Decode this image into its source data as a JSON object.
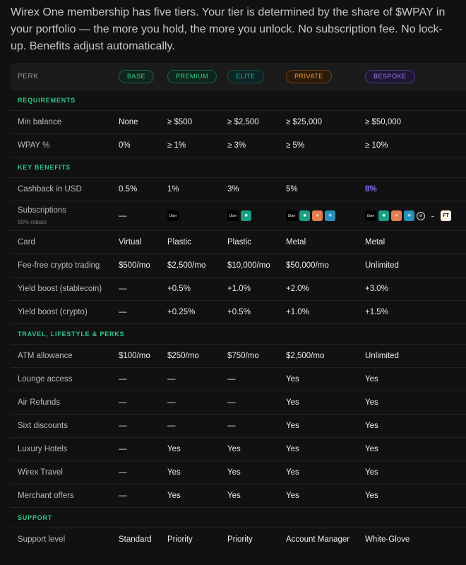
{
  "intro": "Wirex One membership has five tiers. Your tier is determined by the share of $WPAY in your portfolio — the more you hold, the more you unlock. No subscription fee. No lock-up. Benefits adjust automatically.",
  "header": {
    "perk": "PERK",
    "tiers": [
      "BASE",
      "PREMIUM",
      "ELITE",
      "PRIVATE",
      "BESPOKE"
    ]
  },
  "sections": {
    "requirements": "REQUIREMENTS",
    "key_benefits": "KEY BENEFITS",
    "travel": "TRAVEL, LIFESTYLE & PERKS",
    "support": "SUPPORT"
  },
  "rows": {
    "min_balance": {
      "label": "Min balance",
      "values": [
        "None",
        "≥ $500",
        "≥ $2,500",
        "≥ $25,000",
        "≥ $50,000"
      ]
    },
    "wpay": {
      "label": "WPAY %",
      "values": [
        "0%",
        "≥ 1%",
        "≥ 3%",
        "≥ 5%",
        "≥ 10%"
      ]
    },
    "cashback": {
      "label": "Cashback in USD",
      "values": [
        "0.5%",
        "1%",
        "3%",
        "5%",
        "8%"
      ]
    },
    "subscriptions": {
      "label": "Subscriptions",
      "note": "50% rebate",
      "base_value": "—"
    },
    "card": {
      "label": "Card",
      "values": [
        "Virtual",
        "Plastic",
        "Plastic",
        "Metal",
        "Metal"
      ]
    },
    "fee_free": {
      "label": "Fee-free crypto trading",
      "values": [
        "$500/mo",
        "$2,500/mo",
        "$10,000/mo",
        "$50,000/mo",
        "Unlimited"
      ]
    },
    "yield_stable": {
      "label": "Yield boost (stablecoin)",
      "values": [
        "—",
        "+0.5%",
        "+1.0%",
        "+2.0%",
        "+3.0%"
      ]
    },
    "yield_crypto": {
      "label": "Yield boost (crypto)",
      "values": [
        "—",
        "+0.25%",
        "+0.5%",
        "+1.0%",
        "+1.5%"
      ]
    },
    "atm": {
      "label": "ATM allowance",
      "values": [
        "$100/mo",
        "$250/mo",
        "$750/mo",
        "$2,500/mo",
        "Unlimited"
      ]
    },
    "lounge": {
      "label": "Lounge access",
      "values": [
        "—",
        "—",
        "—",
        "Yes",
        "Yes"
      ]
    },
    "air_refunds": {
      "label": "Air Refunds",
      "values": [
        "—",
        "—",
        "—",
        "Yes",
        "Yes"
      ]
    },
    "sixt": {
      "label": "Sixt discounts",
      "values": [
        "—",
        "—",
        "—",
        "Yes",
        "Yes"
      ]
    },
    "hotels": {
      "label": "Luxury Hotels",
      "values": [
        "—",
        "Yes",
        "Yes",
        "Yes",
        "Yes"
      ]
    },
    "travel": {
      "label": "Wirex Travel",
      "values": [
        "—",
        "Yes",
        "Yes",
        "Yes",
        "Yes"
      ]
    },
    "merchant": {
      "label": "Merchant offers",
      "values": [
        "—",
        "Yes",
        "Yes",
        "Yes",
        "Yes"
      ]
    },
    "support_level": {
      "label": "Support level",
      "values": [
        "Standard",
        "Priority",
        "Priority",
        "Account Manager",
        "White-Glove"
      ]
    }
  },
  "logos": {
    "uber": "Uber",
    "ft": "FT"
  },
  "colors": {
    "accent_green": "#33c98a",
    "highlight_purple": "#8b6cff",
    "private_orange": "#f59a3a"
  }
}
